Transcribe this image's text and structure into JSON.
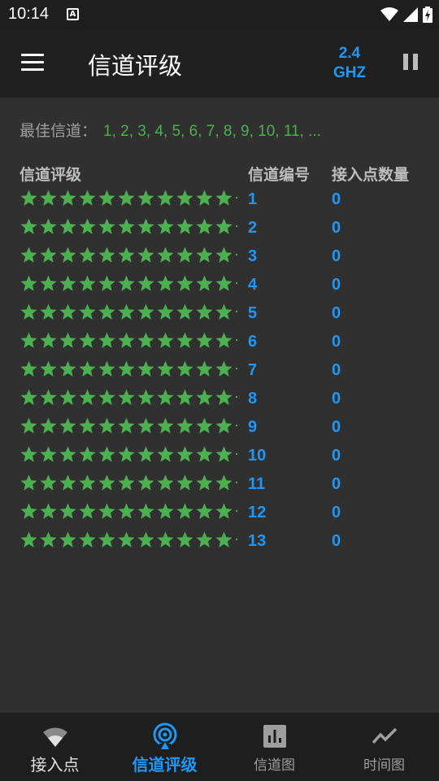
{
  "status_bar": {
    "time": "10:14",
    "notification_letter": "A"
  },
  "app_bar": {
    "title": "信道评级",
    "band_line1": "2.4",
    "band_line2": "GHZ"
  },
  "best_channels": {
    "label": "最佳信道：",
    "value": "1, 2, 3, 4, 5, 6, 7, 8, 9, 10, 11, ..."
  },
  "columns": {
    "rating": "信道评级",
    "channel": "信道编号",
    "ap_count": "接入点数量"
  },
  "rows": [
    {
      "channel": "1",
      "ap_count": "0",
      "stars": 11
    },
    {
      "channel": "2",
      "ap_count": "0",
      "stars": 11
    },
    {
      "channel": "3",
      "ap_count": "0",
      "stars": 11
    },
    {
      "channel": "4",
      "ap_count": "0",
      "stars": 11
    },
    {
      "channel": "5",
      "ap_count": "0",
      "stars": 11
    },
    {
      "channel": "6",
      "ap_count": "0",
      "stars": 11
    },
    {
      "channel": "7",
      "ap_count": "0",
      "stars": 11
    },
    {
      "channel": "8",
      "ap_count": "0",
      "stars": 11
    },
    {
      "channel": "9",
      "ap_count": "0",
      "stars": 11
    },
    {
      "channel": "10",
      "ap_count": "0",
      "stars": 11
    },
    {
      "channel": "11",
      "ap_count": "0",
      "stars": 11
    },
    {
      "channel": "12",
      "ap_count": "0",
      "stars": 11
    },
    {
      "channel": "13",
      "ap_count": "0",
      "stars": 11
    }
  ],
  "bottom_nav": [
    {
      "label": "接入点",
      "icon": "wifi-icon"
    },
    {
      "label": "信道评级",
      "icon": "signal-rating-icon"
    },
    {
      "label": "信道图",
      "icon": "bar-chart-icon"
    },
    {
      "label": "时间图",
      "icon": "line-chart-icon"
    }
  ],
  "colors": {
    "accent": "#2196f3",
    "star": "#4caf50",
    "background": "#303030",
    "toolbar": "#202020"
  }
}
